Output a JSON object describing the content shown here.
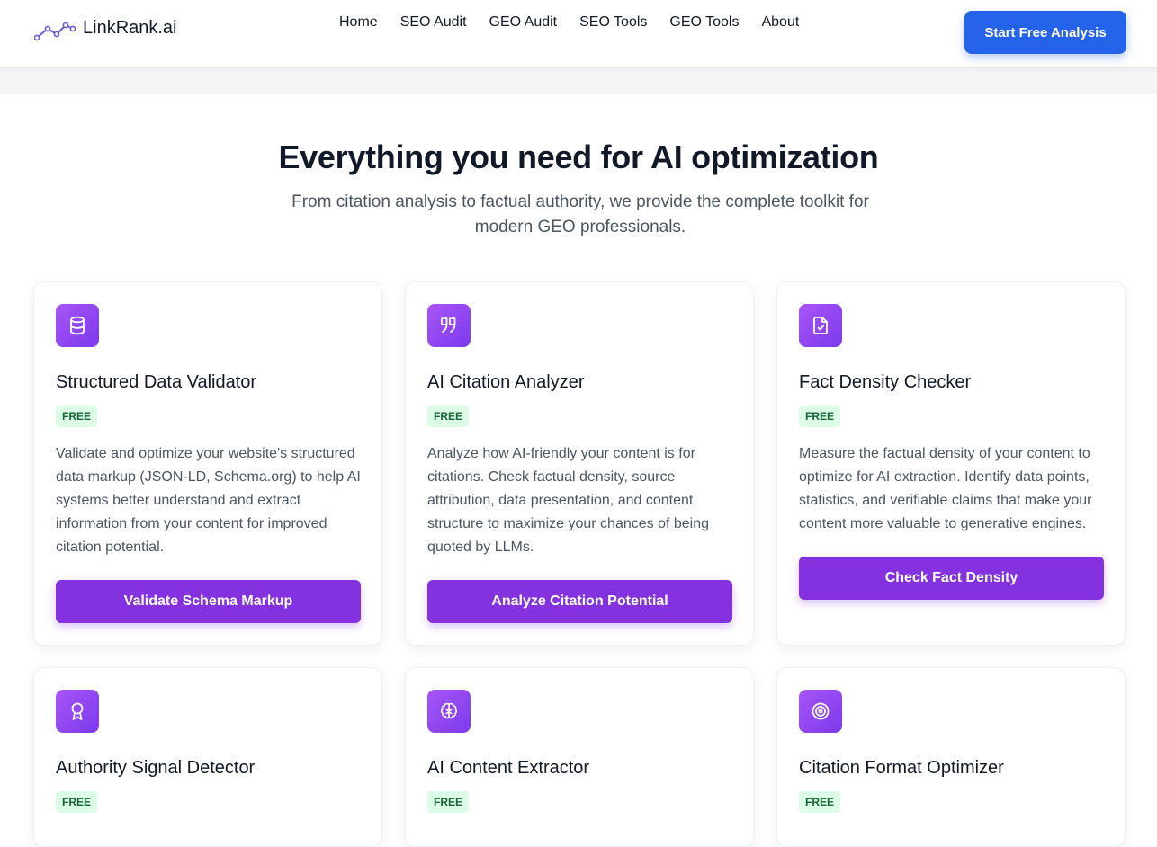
{
  "header": {
    "logo_text": "LinkRank.ai",
    "nav": [
      "Home",
      "SEO Audit",
      "GEO Audit",
      "SEO Tools",
      "GEO Tools",
      "About"
    ],
    "cta_label": "Start Free Analysis"
  },
  "hero": {
    "title": "Everything you need for AI optimization",
    "subtitle": "From citation analysis to factual authority, we provide the complete toolkit for modern GEO professionals."
  },
  "cards": [
    {
      "icon": "database-icon",
      "title": "Structured Data Validator",
      "badge": "FREE",
      "description": "Validate and optimize your website's structured data markup (JSON-LD, Schema.org) to help AI systems better understand and extract information from your content for improved citation potential.",
      "button": "Validate Schema Markup"
    },
    {
      "icon": "quote-icon",
      "title": "AI Citation Analyzer",
      "badge": "FREE",
      "description": "Analyze how AI-friendly your content is for citations. Check factual density, source attribution, data presentation, and content structure to maximize your chances of being quoted by LLMs.",
      "button": "Analyze Citation Potential"
    },
    {
      "icon": "file-check-icon",
      "title": "Fact Density Checker",
      "badge": "FREE",
      "description": "Measure the factual density of your content to optimize for AI extraction. Identify data points, statistics, and verifiable claims that make your content more valuable to generative engines.",
      "button": "Check Fact Density"
    },
    {
      "icon": "award-icon",
      "title": "Authority Signal Detector",
      "badge": "FREE"
    },
    {
      "icon": "brain-icon",
      "title": "AI Content Extractor",
      "badge": "FREE"
    },
    {
      "icon": "target-icon",
      "title": "Citation Format Optimizer",
      "badge": "FREE"
    }
  ],
  "colors": {
    "primary_blue": "#2563eb",
    "purple": "#8431e0",
    "badge_bg": "#dcfce7",
    "badge_text": "#166534"
  }
}
